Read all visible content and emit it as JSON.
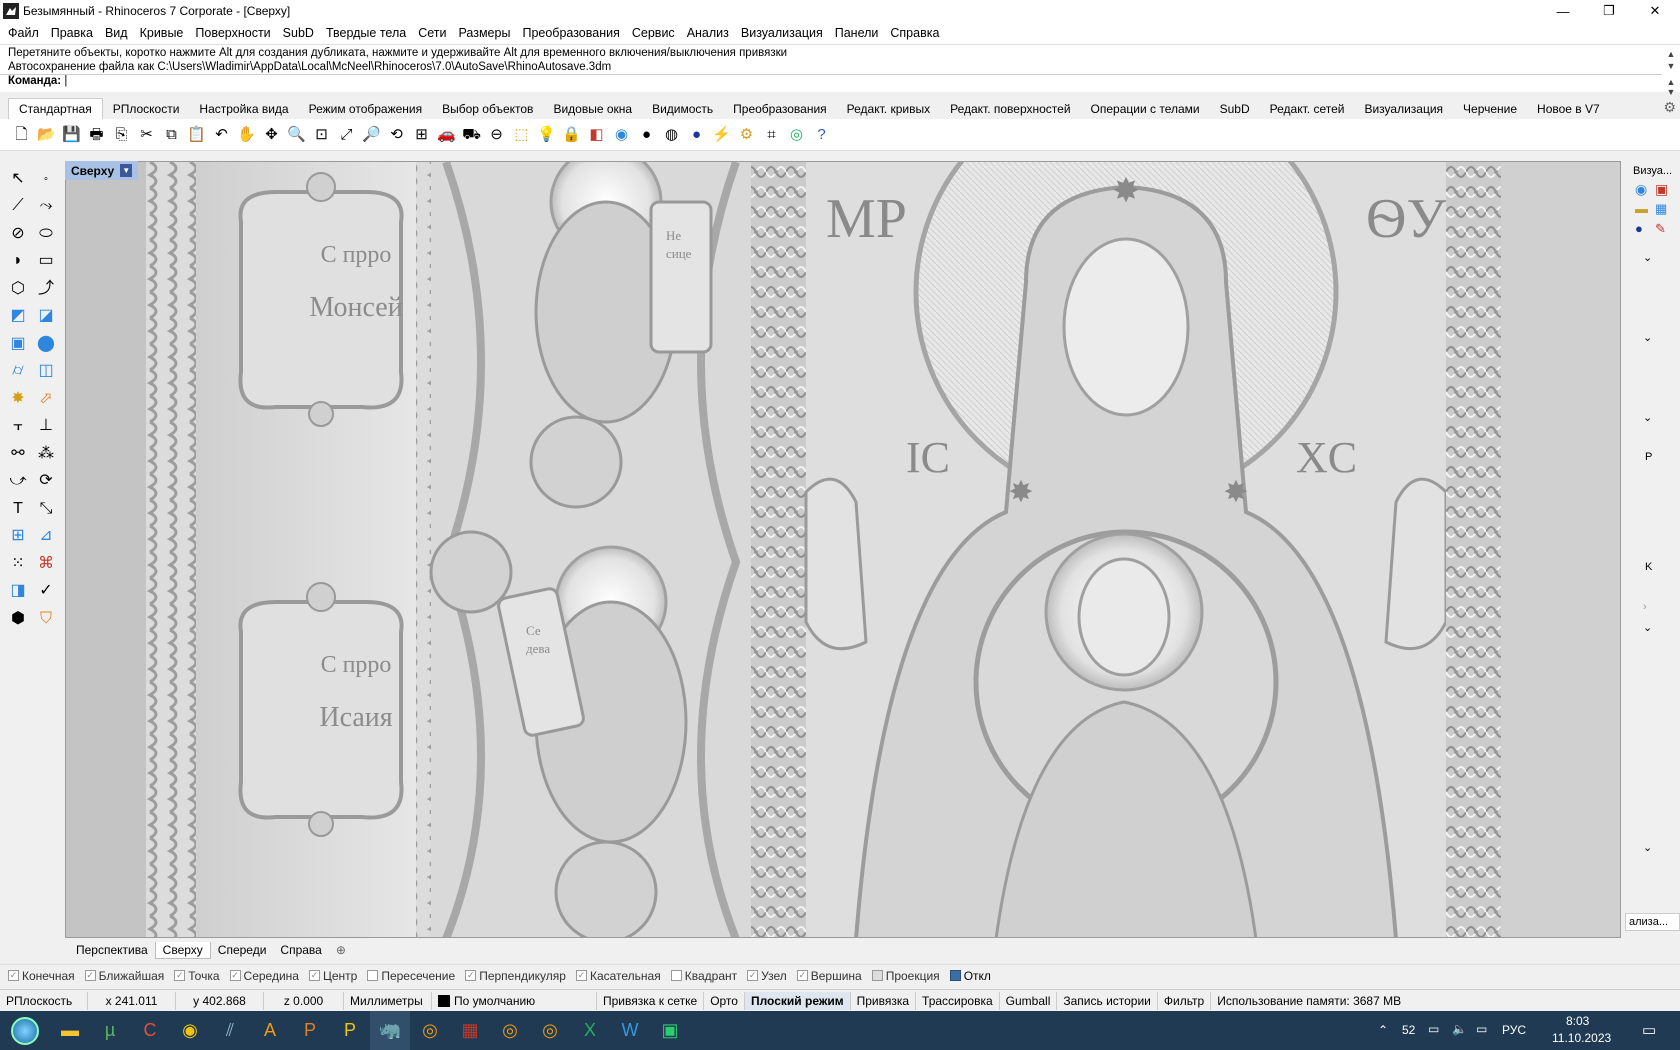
{
  "window": {
    "title": "Безымянный - Rhinoceros 7 Corporate - [Сверху]",
    "minimize": "—",
    "restore": "❐",
    "close": "✕"
  },
  "menu": [
    "Файл",
    "Правка",
    "Вид",
    "Кривые",
    "Поверхности",
    "SubD",
    "Твердые тела",
    "Сети",
    "Размеры",
    "Преобразования",
    "Сервис",
    "Анализ",
    "Визуализация",
    "Панели",
    "Справка"
  ],
  "command": {
    "history_1": "Перетяните объекты, коротко нажмите Alt для создания дубликата, нажмите и удерживайте Alt для временного включения/выключения привязки",
    "history_2": "Автосохранение файла как C:\\Users\\Wladimir\\AppData\\Local\\McNeel\\Rhinoceros\\7.0\\AutoSave\\RhinoAutosave.3dm",
    "prompt": "Команда:"
  },
  "toolbar_tabs": [
    "Стандартная",
    "РПлоскости",
    "Настройка вида",
    "Режим отображения",
    "Выбор объектов",
    "Видовые окна",
    "Видимость",
    "Преобразования",
    "Редакт. кривых",
    "Редакт. поверхностей",
    "Операции с телами",
    "SubD",
    "Редакт. сетей",
    "Визуализация",
    "Черчение",
    "Новое в V7"
  ],
  "viewport": {
    "label": "Сверху",
    "inscription_1a": "С пррo",
    "inscription_1b": "Монсей",
    "inscription_2a": "С пррo",
    "inscription_2b": "Исаия",
    "mono_left": "МР",
    "mono_right": "ѲУ",
    "ic": "IC",
    "xc": "XC",
    "scroll_1": "Не сице",
    "scroll_2": "Се дева"
  },
  "right_panel": {
    "title": "Визуа...",
    "bottom": "ализа...",
    "p": "P",
    "k": "K"
  },
  "view_tabs": [
    "Перспектива",
    "Сверху",
    "Спереди",
    "Справа"
  ],
  "osnaps": [
    {
      "label": "Конечная",
      "checked": true
    },
    {
      "label": "Ближайшая",
      "checked": true
    },
    {
      "label": "Точка",
      "checked": true
    },
    {
      "label": "Середина",
      "checked": true
    },
    {
      "label": "Центр",
      "checked": true
    },
    {
      "label": "Пересечение",
      "checked": false
    },
    {
      "label": "Перпендикуляр",
      "checked": true
    },
    {
      "label": "Касательная",
      "checked": true
    },
    {
      "label": "Квадрант",
      "checked": false
    },
    {
      "label": "Узел",
      "checked": true
    },
    {
      "label": "Вершина",
      "checked": true
    },
    {
      "label": "Проекция",
      "checked": false
    },
    {
      "label": "Откл",
      "checked": true
    }
  ],
  "status": {
    "cplane": "РПлоскость",
    "x": "x 241.011",
    "y": "y 402.868",
    "z": "z 0.000",
    "units": "Миллиметры",
    "layer": "По умолчанию",
    "grid_snap": "Привязка к сетке",
    "ortho": "Орто",
    "planar": "Плоский режим",
    "osnap": "Привязка",
    "smarttrack": "Трассировка",
    "gumball": "Gumball",
    "history": "Запись истории",
    "filter": "Фильтр",
    "memory": "Использование памяти: 3687 MB"
  },
  "taskbar": {
    "time": "8:03",
    "date": "11.10.2023",
    "lang": "РУС",
    "temp": "52"
  }
}
